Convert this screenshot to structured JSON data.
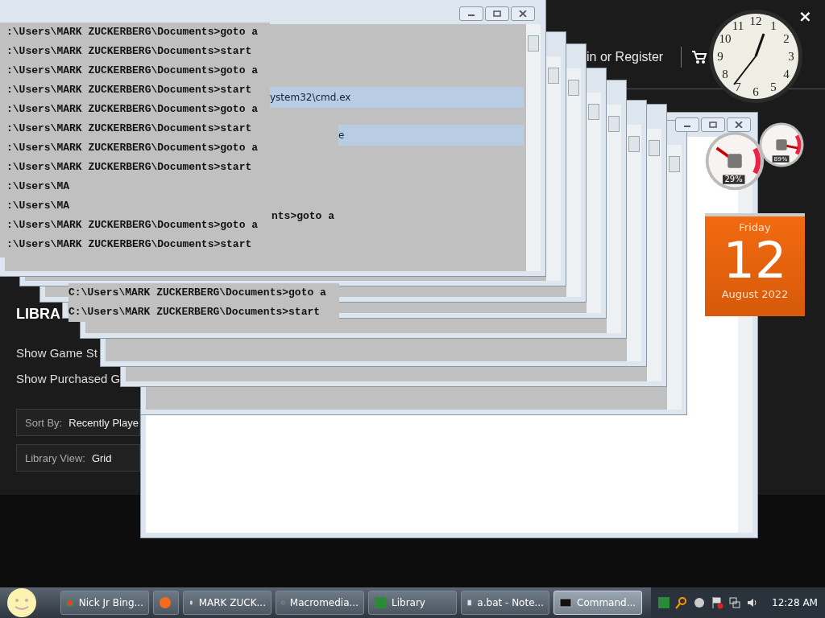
{
  "background_app": {
    "header_link": "in or Register",
    "section_title": "LIBRA",
    "filters": [
      "Show Game St",
      "Show Purchased G"
    ],
    "sort_by": {
      "label": "Sort By:",
      "value": "Recently Playe"
    },
    "library_view": {
      "label": "Library View:",
      "value": "Grid"
    }
  },
  "windows": {
    "titles": [
      "ystem32\\cmd.ex",
      "e"
    ],
    "front_console_lines": [
      ":\\Users\\MARK ZUCKERBERG\\Documents>goto a",
      ":\\Users\\MARK ZUCKERBERG\\Documents>start",
      ":\\Users\\MARK ZUCKERBERG\\Documents>goto a",
      ":\\Users\\MARK ZUCKERBERG\\Documents>start",
      ":\\Users\\MARK ZUCKERBERG\\Documents>goto a",
      ":\\Users\\MARK ZUCKERBERG\\Documents>start",
      ":\\Users\\MARK ZUCKERBERG\\Documents>goto a",
      ":\\Users\\MARK ZUCKERBERG\\Documents>start",
      ":\\Users\\MA",
      ":\\Users\\MA",
      ":\\Users\\MARK ZUCKERBERG\\Documents>goto a",
      ":\\Users\\MARK ZUCKERBERG\\Documents>start"
    ],
    "fragment_line": "nts>goto a",
    "back_console_lines": [
      "C:\\Users\\MARK ZUCKERBERG\\Documents>goto a",
      "C:\\Users\\MARK ZUCKERBERG\\Documents>start"
    ]
  },
  "gadgets": {
    "close": "×",
    "clock_numerals": [
      "12",
      "1",
      "2",
      "3",
      "4",
      "5",
      "6",
      "7",
      "8",
      "9",
      "10",
      "11"
    ],
    "meters": [
      {
        "reading": "29%",
        "level": 0.29
      },
      {
        "reading": "89%",
        "level": 0.89
      }
    ],
    "calendar": {
      "weekday": "Friday",
      "day": "12",
      "month": "August 2022"
    }
  },
  "taskbar": {
    "tasks": [
      {
        "label": "Nick Jr Bing...",
        "selected": false
      },
      {
        "selected": false
      },
      {
        "label": "MARK ZUCK...",
        "selected": false
      },
      {
        "label": "Macromedia...",
        "selected": false
      },
      {
        "label": "Library",
        "selected": false
      },
      {
        "label": "a.bat - Note...",
        "selected": false
      },
      {
        "label": "Command...",
        "selected": true
      }
    ],
    "clock": "12:28 AM"
  }
}
